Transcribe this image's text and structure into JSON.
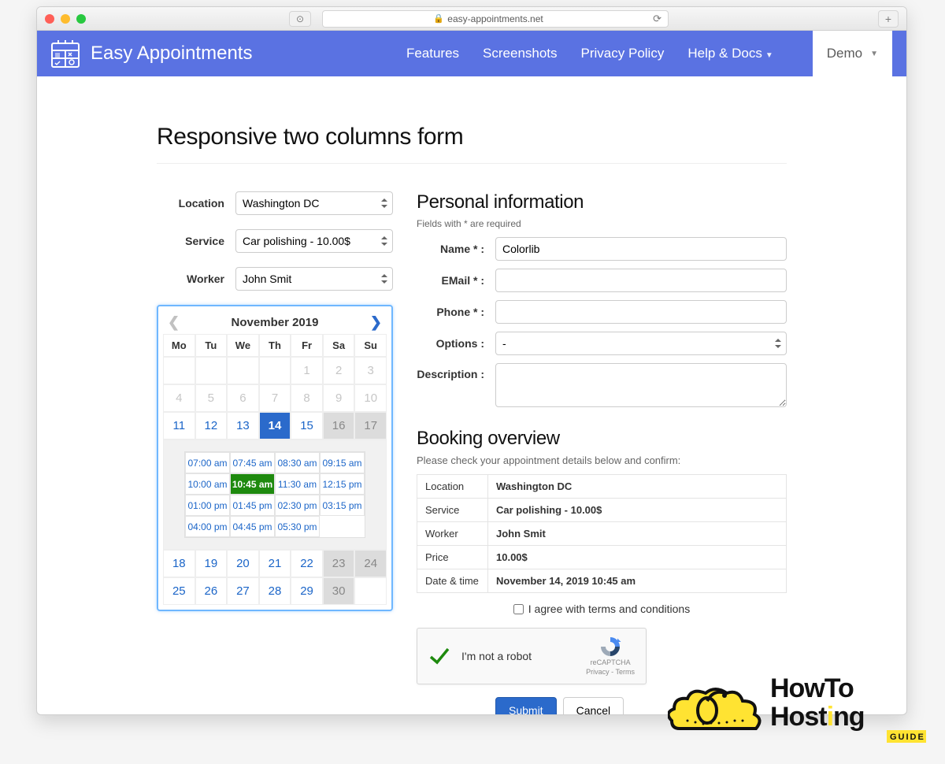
{
  "browser": {
    "url": "easy-appointments.net"
  },
  "nav": {
    "brand": "Easy Appointments",
    "links": [
      "Features",
      "Screenshots",
      "Privacy Policy",
      "Help & Docs"
    ],
    "demo": "Demo"
  },
  "page_title": "Responsive two columns form",
  "left": {
    "labels": {
      "location": "Location",
      "service": "Service",
      "worker": "Worker"
    },
    "location_value": "Washington DC",
    "service_value": "Car polishing - 10.00$",
    "worker_value": "John Smit"
  },
  "calendar": {
    "month_label": "November 2019",
    "dow": [
      "Mo",
      "Tu",
      "We",
      "Th",
      "Fr",
      "Sa",
      "Su"
    ],
    "weeks": [
      [
        {
          "d": "",
          "t": "blank"
        },
        {
          "d": "",
          "t": "blank"
        },
        {
          "d": "",
          "t": "blank"
        },
        {
          "d": "",
          "t": "blank"
        },
        {
          "d": "1",
          "t": "disabled"
        },
        {
          "d": "2",
          "t": "disabled"
        },
        {
          "d": "3",
          "t": "disabled"
        }
      ],
      [
        {
          "d": "4",
          "t": "disabled"
        },
        {
          "d": "5",
          "t": "disabled"
        },
        {
          "d": "6",
          "t": "disabled"
        },
        {
          "d": "7",
          "t": "disabled"
        },
        {
          "d": "8",
          "t": "disabled"
        },
        {
          "d": "9",
          "t": "disabled"
        },
        {
          "d": "10",
          "t": "disabled"
        }
      ],
      [
        {
          "d": "11",
          "t": "avail"
        },
        {
          "d": "12",
          "t": "avail"
        },
        {
          "d": "13",
          "t": "avail"
        },
        {
          "d": "14",
          "t": "selected"
        },
        {
          "d": "15",
          "t": "avail"
        },
        {
          "d": "16",
          "t": "weekend-dis"
        },
        {
          "d": "17",
          "t": "weekend-dis"
        }
      ]
    ],
    "timeslots": [
      [
        {
          "t": "07:00 am"
        },
        {
          "t": "07:45 am"
        },
        {
          "t": "08:30 am"
        },
        {
          "t": "09:15 am"
        }
      ],
      [
        {
          "t": "10:00 am"
        },
        {
          "t": "10:45 am",
          "sel": true
        },
        {
          "t": "11:30 am"
        },
        {
          "t": "12:15 pm"
        }
      ],
      [
        {
          "t": "01:00 pm"
        },
        {
          "t": "01:45 pm"
        },
        {
          "t": "02:30 pm"
        },
        {
          "t": "03:15 pm"
        }
      ],
      [
        {
          "t": "04:00 pm"
        },
        {
          "t": "04:45 pm"
        },
        {
          "t": "05:30 pm"
        }
      ]
    ],
    "weeks_after": [
      [
        {
          "d": "18",
          "t": "avail"
        },
        {
          "d": "19",
          "t": "avail"
        },
        {
          "d": "20",
          "t": "avail"
        },
        {
          "d": "21",
          "t": "avail"
        },
        {
          "d": "22",
          "t": "avail"
        },
        {
          "d": "23",
          "t": "weekend-dis"
        },
        {
          "d": "24",
          "t": "weekend-dis"
        }
      ],
      [
        {
          "d": "25",
          "t": "avail"
        },
        {
          "d": "26",
          "t": "avail"
        },
        {
          "d": "27",
          "t": "avail"
        },
        {
          "d": "28",
          "t": "avail"
        },
        {
          "d": "29",
          "t": "avail"
        },
        {
          "d": "30",
          "t": "weekend-dis"
        },
        {
          "d": "",
          "t": "blank"
        }
      ]
    ]
  },
  "personal": {
    "heading": "Personal information",
    "hint": "Fields with * are required",
    "labels": {
      "name": "Name * :",
      "email": "EMail * :",
      "phone": "Phone * :",
      "options": "Options :",
      "description": "Description :"
    },
    "name_value": "Colorlib",
    "options_value": "-"
  },
  "overview": {
    "heading": "Booking overview",
    "hint": "Please check your appointment details below and confirm:",
    "rows": [
      {
        "k": "Location",
        "v": "Washington DC"
      },
      {
        "k": "Service",
        "v": "Car polishing - 10.00$"
      },
      {
        "k": "Worker",
        "v": "John Smit"
      },
      {
        "k": "Price",
        "v": "10.00$"
      },
      {
        "k": "Date & time",
        "v": "November 14, 2019 10:45 am"
      }
    ],
    "terms_label": "I agree with terms and conditions",
    "recaptcha_label": "I'm not a robot",
    "recaptcha_brand": "reCAPTCHA",
    "recaptcha_links": "Privacy - Terms",
    "submit": "Submit",
    "cancel": "Cancel"
  },
  "watermark": {
    "line1": "HowTo",
    "line2": "Hosting",
    "badge": "GUIDE"
  }
}
